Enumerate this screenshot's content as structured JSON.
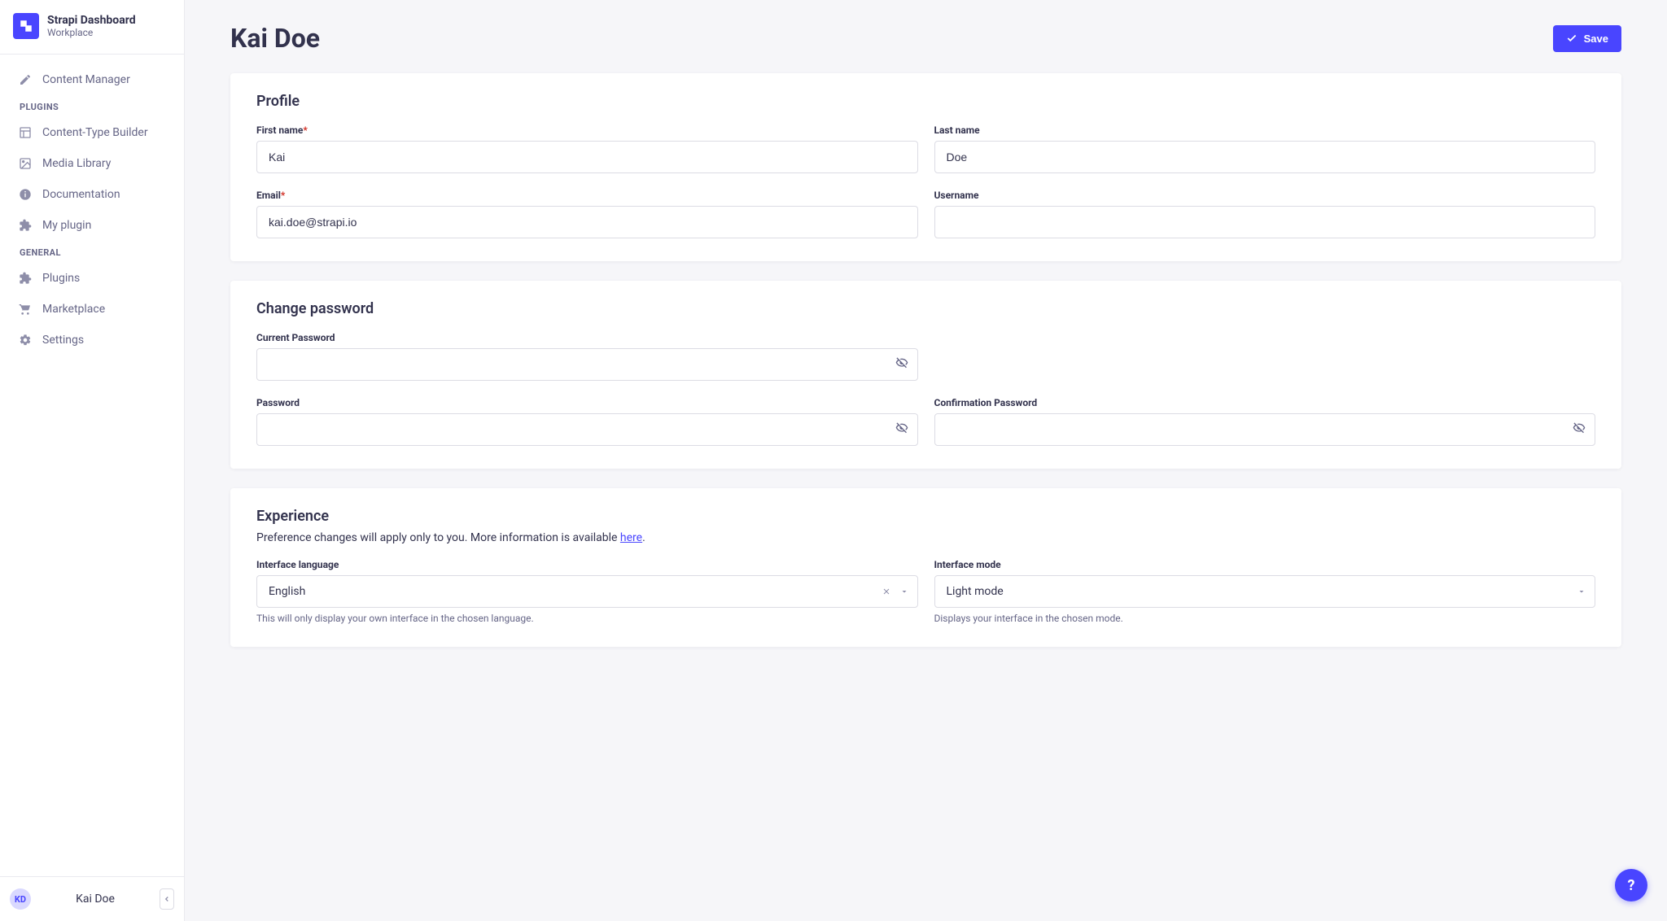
{
  "app": {
    "title": "Strapi Dashboard",
    "subtitle": "Workplace"
  },
  "nav": {
    "top_item": {
      "label": "Content Manager"
    },
    "sections": [
      {
        "label": "PLUGINS",
        "items": [
          {
            "key": "ctb",
            "label": "Content-Type Builder"
          },
          {
            "key": "media",
            "label": "Media Library"
          },
          {
            "key": "docs",
            "label": "Documentation"
          },
          {
            "key": "myplugin",
            "label": "My plugin"
          }
        ]
      },
      {
        "label": "GENERAL",
        "items": [
          {
            "key": "plugins",
            "label": "Plugins"
          },
          {
            "key": "marketplace",
            "label": "Marketplace"
          },
          {
            "key": "settings",
            "label": "Settings"
          }
        ]
      }
    ]
  },
  "footer": {
    "initials": "KD",
    "name": "Kai Doe"
  },
  "header": {
    "page_title": "Kai Doe",
    "save_label": "Save"
  },
  "profile": {
    "section_title": "Profile",
    "first_name": {
      "label": "First name",
      "required": true,
      "value": "Kai"
    },
    "last_name": {
      "label": "Last name",
      "required": false,
      "value": "Doe"
    },
    "email": {
      "label": "Email",
      "required": true,
      "value": "kai.doe@strapi.io"
    },
    "username": {
      "label": "Username",
      "required": false,
      "value": ""
    }
  },
  "password": {
    "section_title": "Change password",
    "current": {
      "label": "Current Password",
      "value": ""
    },
    "new": {
      "label": "Password",
      "value": ""
    },
    "confirmation": {
      "label": "Confirmation Password",
      "value": ""
    }
  },
  "experience": {
    "section_title": "Experience",
    "subtitle_pre": "Preference changes will apply only to you. More information is available ",
    "subtitle_link": "here",
    "subtitle_post": ".",
    "language": {
      "label": "Interface language",
      "value": "English",
      "helper": "This will only display your own interface in the chosen language."
    },
    "mode": {
      "label": "Interface mode",
      "value": "Light mode",
      "helper": "Displays your interface in the chosen mode."
    }
  },
  "help": {
    "label": "?"
  }
}
